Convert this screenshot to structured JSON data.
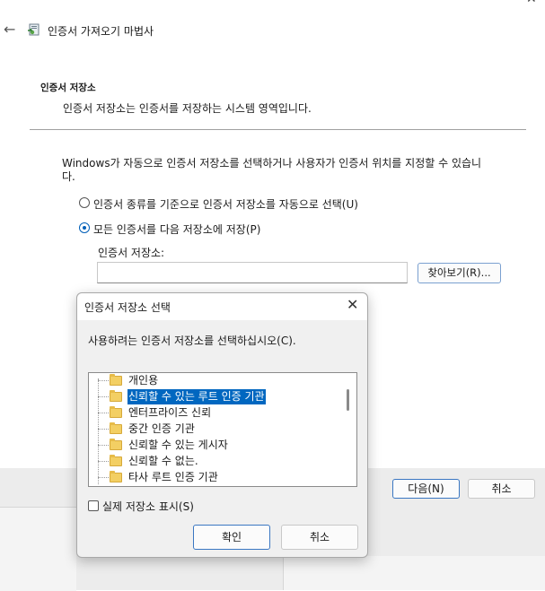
{
  "window": {
    "title": "인증서 가져오기 마법사",
    "back_icon": "back-arrow-icon",
    "app_icon": "certificate-wizard-icon",
    "close_icon": "close-icon"
  },
  "section": {
    "title": "인증서 저장소",
    "description": "인증서 저장소는 인증서를 저장하는 시스템 영역입니다."
  },
  "intro": "Windows가 자동으로 인증서 저장소를 선택하거나 사용자가 인증서 위치를 지정할 수 있습니다.",
  "options": {
    "auto_label": "인증서 종류를 기준으로 인증서 저장소를 자동으로 선택(U)",
    "manual_label": "모든 인증서를 다음 저장소에 저장(P)",
    "selected": "manual"
  },
  "store": {
    "label": "인증서 저장소:",
    "value": "",
    "browse_label": "찾아보기(R)..."
  },
  "footer": {
    "next_label": "다음(N)",
    "cancel_label": "취소"
  },
  "dialog": {
    "title": "인증서 저장소 선택",
    "prompt": "사용하려는 인증서 저장소를 선택하십시오(C).",
    "stores": [
      {
        "label": "개인용",
        "selected": false
      },
      {
        "label": "신뢰할 수 있는 루트 인증 기관",
        "selected": true
      },
      {
        "label": "엔터프라이즈 신뢰",
        "selected": false
      },
      {
        "label": "중간 인증 기관",
        "selected": false
      },
      {
        "label": "신뢰할 수 있는 게시자",
        "selected": false
      },
      {
        "label": "신뢰할 수 없는.",
        "selected": false
      },
      {
        "label": "타사 루트 인증 기관",
        "selected": false
      }
    ],
    "show_physical_label": "실제 저장소 표시(S)",
    "show_physical_checked": false,
    "ok_label": "확인",
    "cancel_label": "취소"
  },
  "colors": {
    "accent": "#005fb8",
    "selection": "#0067c0",
    "folder": "#f3cf63"
  }
}
